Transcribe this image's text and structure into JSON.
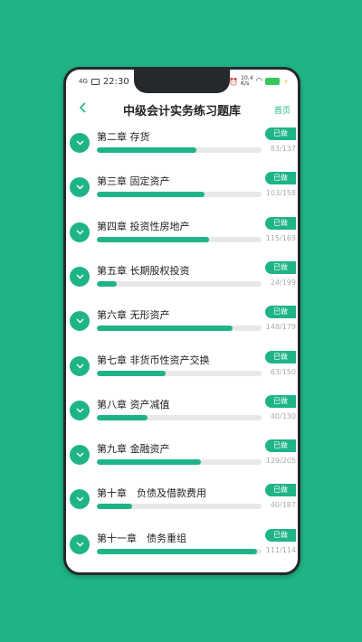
{
  "status_bar": {
    "signal": "4G",
    "time": "22:30",
    "network_speed": "10.4",
    "network_unit": "K/s"
  },
  "header": {
    "back_icon": "chevron-left-icon",
    "title": "中级会计实务练习题库",
    "home_label": "首页"
  },
  "colors": {
    "accent": "#1fb488",
    "track": "#e8e8e8",
    "background": "#1fb488"
  },
  "chapters": [
    {
      "title": "第二章 存货",
      "status": "已做",
      "done": 83,
      "total": 137,
      "progress_label": "83/137"
    },
    {
      "title": "第三章 固定资产",
      "status": "已做",
      "done": 103,
      "total": 158,
      "progress_label": "103/158"
    },
    {
      "title": "第四章 投资性房地产",
      "status": "已做",
      "done": 115,
      "total": 169,
      "progress_label": "115/169"
    },
    {
      "title": "第五章 长期股权投资",
      "status": "已做",
      "done": 24,
      "total": 199,
      "progress_label": "24/199"
    },
    {
      "title": "第六章 无形资产",
      "status": "已做",
      "done": 148,
      "total": 179,
      "progress_label": "148/179"
    },
    {
      "title": "第七章 非货币性资产交换",
      "status": "已做",
      "done": 63,
      "total": 150,
      "progress_label": "63/150"
    },
    {
      "title": "第八章 资产减值",
      "status": "已做",
      "done": 40,
      "total": 130,
      "progress_label": "40/130"
    },
    {
      "title": "第九章 金融资产",
      "status": "已做",
      "done": 129,
      "total": 205,
      "progress_label": "129/205"
    },
    {
      "title": "第十章　负债及借款费用",
      "status": "已做",
      "done": 40,
      "total": 187,
      "progress_label": "40/187"
    },
    {
      "title": "第十一章　债务重组",
      "status": "已做",
      "done": 111,
      "total": 114,
      "progress_label": "111/114"
    }
  ]
}
